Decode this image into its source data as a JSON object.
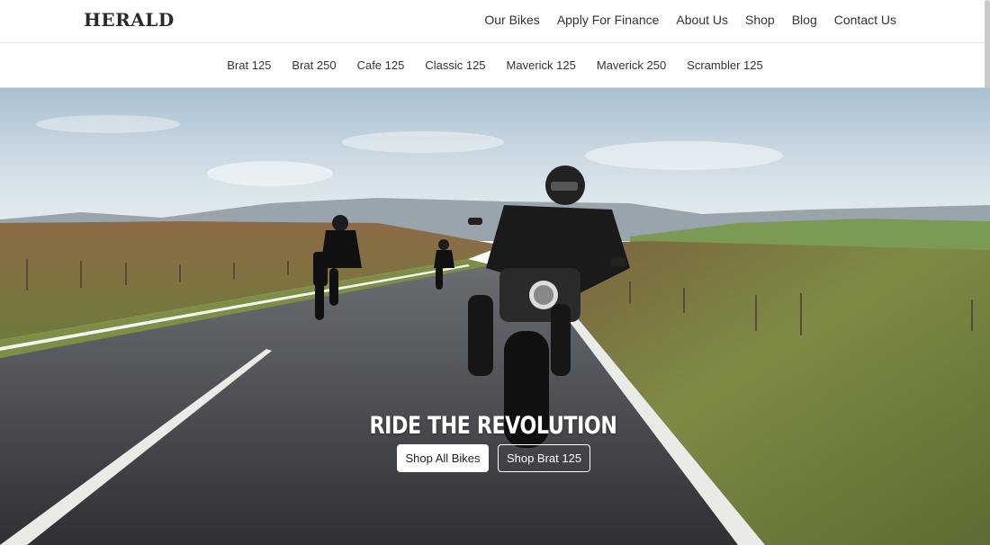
{
  "brand": {
    "logo_text": "HERALD"
  },
  "main_nav": {
    "items": [
      "Our Bikes",
      "Apply For Finance",
      "About Us",
      "Shop",
      "Blog",
      "Contact Us"
    ]
  },
  "sub_nav": {
    "items": [
      "Brat 125",
      "Brat 250",
      "Cafe 125",
      "Classic 125",
      "Maverick 125",
      "Maverick 250",
      "Scrambler 125"
    ]
  },
  "hero": {
    "title": "RIDE THE REVOLUTION",
    "primary_button": "Shop All Bikes",
    "secondary_button": "Shop Brat 125"
  },
  "colors": {
    "sky_top": "#b8cbd8",
    "road": "#3c3f45",
    "grass": "#7c8a42",
    "moor": "#8a6a47"
  }
}
